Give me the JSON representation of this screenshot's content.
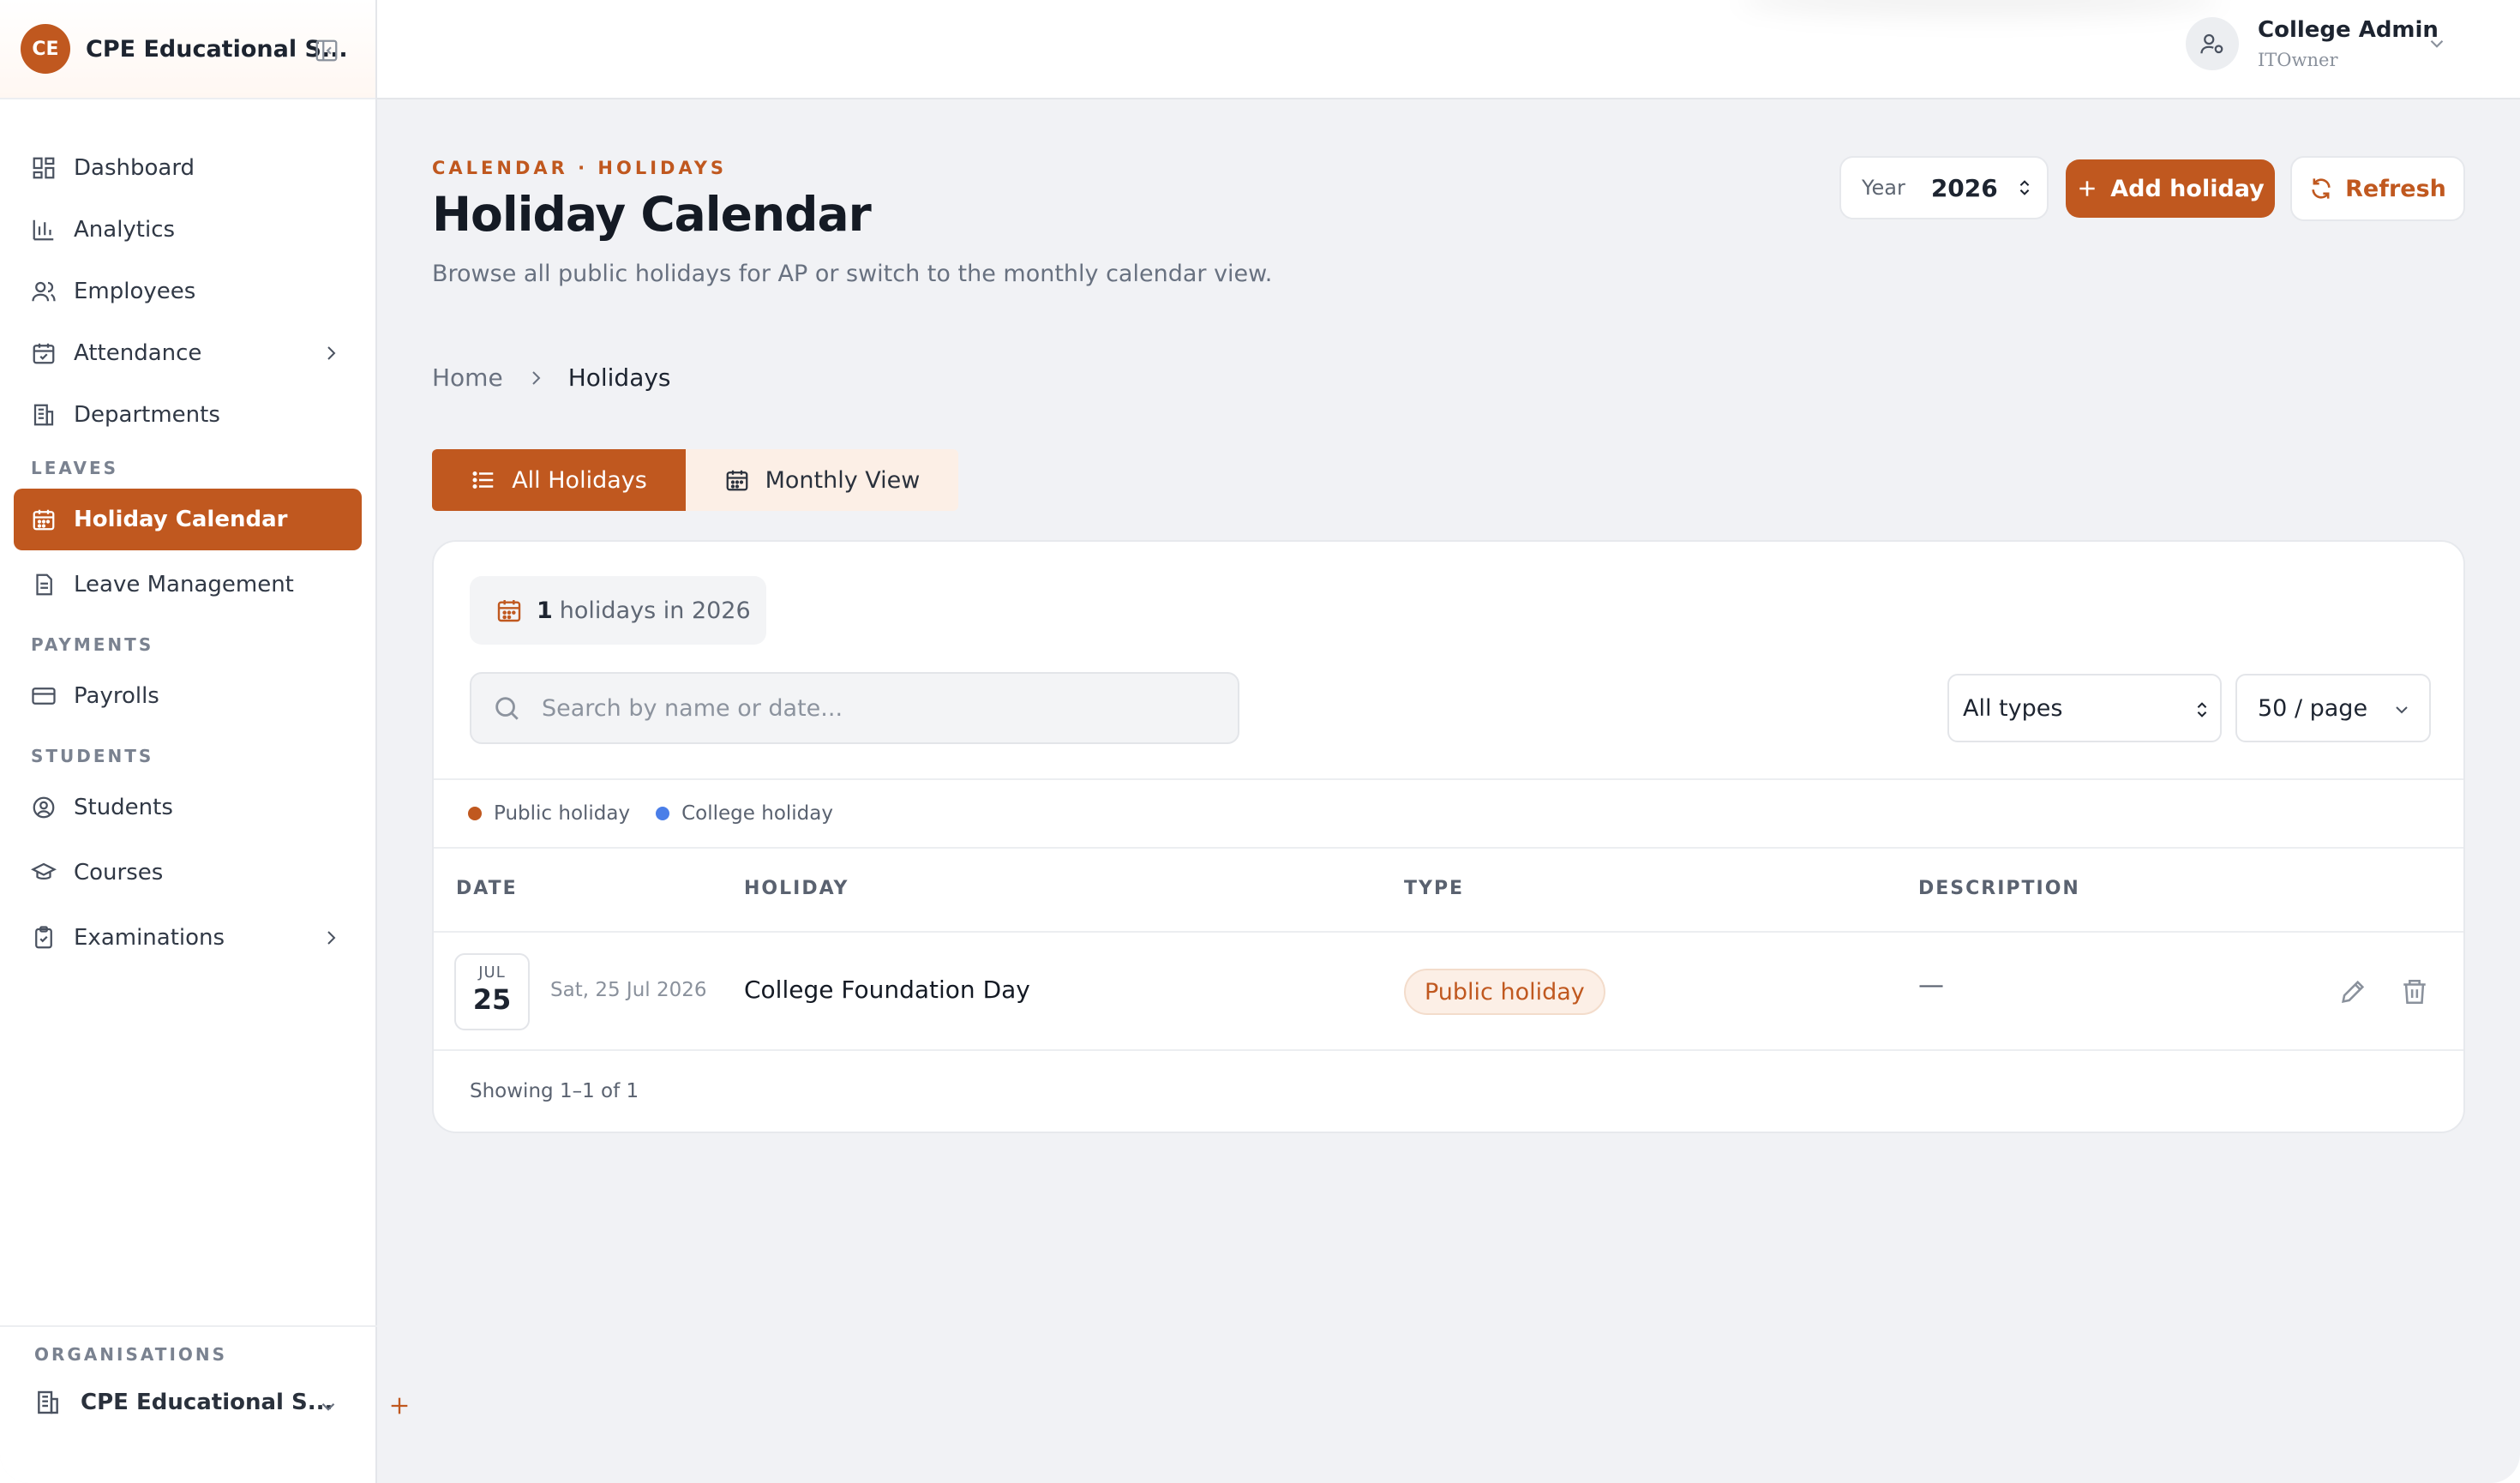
{
  "org": {
    "initials": "CE",
    "name": "CPE Educational S..."
  },
  "nav": {
    "items": [
      {
        "label": "Dashboard"
      },
      {
        "label": "Analytics"
      },
      {
        "label": "Employees"
      },
      {
        "label": "Attendance"
      },
      {
        "label": "Departments"
      }
    ],
    "sections": {
      "leaves": "LEAVES",
      "payments": "PAYMENTS",
      "students": "STUDENTS"
    },
    "leaves_items": [
      {
        "label": "Holiday Calendar",
        "active": true
      },
      {
        "label": "Leave Management"
      }
    ],
    "payments_items": [
      {
        "label": "Payrolls"
      }
    ],
    "students_items": [
      {
        "label": "Students"
      },
      {
        "label": "Courses"
      },
      {
        "label": "Examinations"
      }
    ]
  },
  "footer": {
    "label": "ORGANISATIONS",
    "org_name": "CPE Educational S..."
  },
  "user": {
    "name": "College Admin",
    "role": "ITOwner"
  },
  "page": {
    "eyebrow": "CALENDAR · HOLIDAYS",
    "title": "Holiday Calendar",
    "subtitle": "Browse all public holidays for AP or switch to the monthly calendar view."
  },
  "controls": {
    "year_label": "Year",
    "year_value": "2026",
    "add_label": "Add holiday",
    "refresh_label": "Refresh"
  },
  "breadcrumb": {
    "home": "Home",
    "current": "Holidays"
  },
  "tabs": {
    "all": "All Holidays",
    "monthly": "Monthly View"
  },
  "summary": {
    "count": "1",
    "text": "holidays in 2026"
  },
  "search": {
    "placeholder": "Search by name or date...",
    "value": ""
  },
  "filters": {
    "type": "All types",
    "page_size": "50 / page"
  },
  "legend": [
    {
      "label": "Public holiday",
      "color": "#c0581f"
    },
    {
      "label": "College holiday",
      "color": "#4a7ee8"
    }
  ],
  "table": {
    "headers": [
      "DATE",
      "HOLIDAY",
      "TYPE",
      "DESCRIPTION"
    ],
    "rows": [
      {
        "month": "JUL",
        "day": "25",
        "full_date": "Sat, 25 Jul 2026",
        "name": "College Foundation Day",
        "type": "Public holiday",
        "description": "—"
      }
    ],
    "footer": "Showing 1–1 of 1"
  },
  "colors": {
    "accent": "#c0581f",
    "accent_soft": "#fcefe6",
    "college_blue": "#4a7ee8"
  }
}
